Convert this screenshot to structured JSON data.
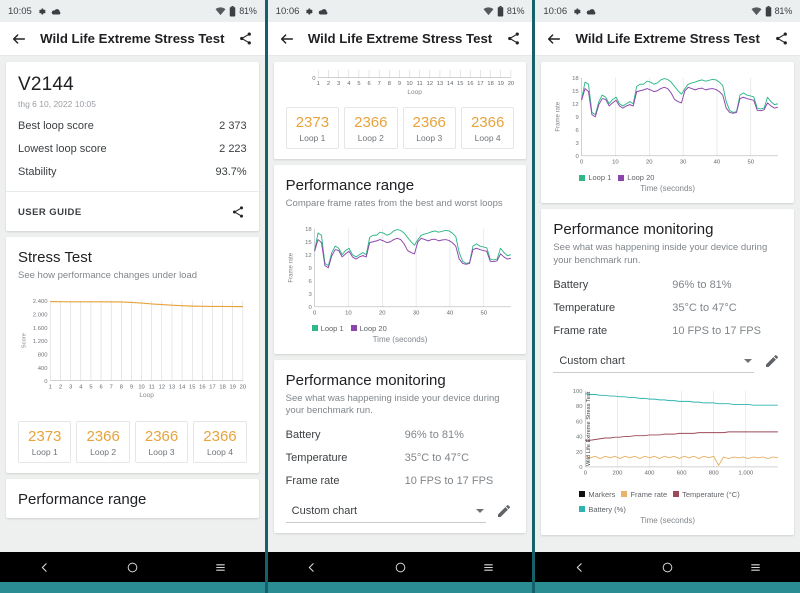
{
  "device": {
    "status_bar": {
      "time_left": "10:05",
      "time_mid": "10:06",
      "time_right": "10:06",
      "battery": "81%",
      "icons": [
        "gear-icon",
        "cloud-icon",
        "wifi-icon",
        "battery-icon"
      ]
    },
    "nav_bar": {
      "back": "back-icon",
      "home": "home-icon",
      "recents": "recents-icon"
    }
  },
  "appbar": {
    "title": "Wild Life Extreme Stress Test",
    "back_icon": "arrow-left-icon",
    "share_icon": "share-icon"
  },
  "summary": {
    "title": "V2144",
    "date": "thg 6 10, 2022 10:05",
    "rows": [
      {
        "label": "Best loop score",
        "value": "2 373"
      },
      {
        "label": "Lowest loop score",
        "value": "2 223"
      },
      {
        "label": "Stability",
        "value": "93.7%"
      }
    ],
    "user_guide": "USER GUIDE"
  },
  "stress_test": {
    "title": "Stress Test",
    "subtitle": "See how performance changes under load"
  },
  "performance_range": {
    "title": "Performance range",
    "subtitle": "Compare frame rates from the best and worst loops"
  },
  "performance_monitoring": {
    "title": "Performance monitoring",
    "subtitle": "See what was happening inside your device during your benchmark run.",
    "rows": [
      {
        "label": "Battery",
        "value": "96% to 81%"
      },
      {
        "label": "Temperature",
        "value": "35°C to 47°C"
      },
      {
        "label": "Frame rate",
        "value": "10 FPS to 17 FPS"
      }
    ],
    "chart_select": {
      "value": "Custom chart",
      "caret": "chevron-down-icon",
      "edit_icon": "pencil-icon"
    }
  },
  "loop_cards": [
    {
      "value": "2373",
      "label": "Loop 1"
    },
    {
      "value": "2366",
      "label": "Loop 2"
    },
    {
      "value": "2366",
      "label": "Loop 3"
    },
    {
      "value": "2366",
      "label": "Loop 4"
    }
  ],
  "colors": {
    "score_line": "#e8a33d",
    "loop1": "#2eb886",
    "loop20": "#8e44ad",
    "markers": "#111111",
    "frame_rate": "#e8b36a",
    "temperature": "#9c4a5a",
    "battery": "#2fb3b0",
    "accent_teal": "#2a8d94"
  },
  "chart_data": [
    {
      "id": "stress-test-chart",
      "type": "line",
      "title": "Stress Test",
      "xlabel": "Loop",
      "ylabel": "Score",
      "xlim": [
        1,
        20
      ],
      "ylim": [
        0,
        2400
      ],
      "yticks": [
        0,
        400,
        800,
        1200,
        1600,
        2000,
        2400
      ],
      "ytick_labels": [
        "0",
        "400",
        "800",
        "1.200",
        "1.600",
        "2.000",
        "2.400"
      ],
      "xticks": [
        1,
        2,
        3,
        4,
        5,
        6,
        7,
        8,
        9,
        10,
        11,
        12,
        13,
        14,
        15,
        16,
        17,
        18,
        19,
        20
      ],
      "grid": "vertical",
      "series": [
        {
          "name": "Score",
          "color": "#e8a33d",
          "values": [
            2373,
            2370,
            2368,
            2368,
            2366,
            2366,
            2365,
            2362,
            2350,
            2330,
            2305,
            2285,
            2265,
            2250,
            2238,
            2232,
            2229,
            2227,
            2225,
            2223
          ]
        }
      ]
    },
    {
      "id": "performance-range-chart",
      "type": "line",
      "title": "Performance range",
      "xlabel": "Time (seconds)",
      "ylabel": "Frame rate",
      "xlim": [
        0,
        58
      ],
      "ylim": [
        0,
        18
      ],
      "yticks": [
        0,
        3,
        6,
        9,
        12,
        15,
        18
      ],
      "xticks": [
        0,
        10,
        20,
        30,
        40,
        50
      ],
      "grid": "vertical",
      "legend": [
        "Loop 1",
        "Loop 20"
      ],
      "series": [
        {
          "name": "Loop 1",
          "color": "#2eb886",
          "values": [
            13,
            17,
            16.5,
            10,
            9.5,
            12.5,
            14,
            13.5,
            12,
            13,
            13.5,
            12,
            11.5,
            12,
            12.5,
            12,
            16,
            16.5,
            16.5,
            17.2,
            17,
            16.5,
            16.8,
            17.5,
            17.8,
            17.6,
            17,
            16,
            15,
            14.2,
            15.5,
            16.5,
            16.8,
            17,
            17.3,
            17.5,
            17.2,
            17.4,
            17.6,
            17.5,
            17,
            16.2,
            12.5,
            10.5,
            10,
            10.2,
            14,
            14.5,
            14,
            13.8,
            13.6,
            11,
            10.8,
            11,
            13.5,
            12.5,
            11.8,
            12
          ]
        },
        {
          "name": "Loop 20",
          "color": "#8e44ad",
          "values": [
            12.8,
            15.5,
            14.8,
            9.5,
            9,
            11.8,
            13.2,
            13,
            11.5,
            12.2,
            12.8,
            11.5,
            11,
            11.5,
            11.8,
            11.5,
            14.8,
            15,
            15.2,
            15.5,
            15.2,
            14.8,
            15,
            15.5,
            15.8,
            15.5,
            14.5,
            13,
            12.5,
            12.2,
            15,
            15.8,
            15.5,
            15.2,
            15.5,
            15.6,
            15.2,
            15.4,
            15.5,
            15.3,
            14.8,
            14,
            11,
            10,
            9.8,
            10,
            13.2,
            13.5,
            13.2,
            13,
            12.8,
            10.5,
            10.4,
            10.6,
            12.2,
            11.5,
            11,
            11.2
          ]
        }
      ]
    },
    {
      "id": "custom-chart",
      "type": "line",
      "title": "Custom chart",
      "xlabel": "Time (seconds)",
      "ylabel": "Wild Life Extreme Stress Test",
      "xlim": [
        0,
        1200
      ],
      "ylim": [
        0,
        100
      ],
      "yticks": [
        0,
        20,
        40,
        60,
        80,
        100
      ],
      "xticks": [
        0,
        200,
        400,
        600,
        800,
        1000
      ],
      "xtick_labels": [
        "0",
        "200",
        "400",
        "600",
        "800",
        "1.000"
      ],
      "grid": "vertical",
      "legend": [
        "Markers",
        "Frame rate",
        "Temperature (°C)",
        "Battery (%)"
      ],
      "series": [
        {
          "name": "Markers",
          "color": "#111111",
          "values": []
        },
        {
          "name": "Frame rate",
          "color": "#e8b36a",
          "values": [
            14,
            12,
            14,
            11,
            14,
            12,
            14,
            11,
            14,
            12,
            14,
            11,
            14,
            12,
            14,
            11,
            14,
            12,
            14,
            11,
            14,
            12,
            14,
            11,
            14,
            12,
            14,
            2,
            13,
            11,
            13,
            12,
            13,
            11,
            13,
            12,
            13,
            11,
            13,
            12
          ]
        },
        {
          "name": "Temperature (°C)",
          "color": "#9c4a5a",
          "values": [
            35,
            35,
            36,
            37,
            38,
            38,
            39,
            39,
            40,
            40,
            41,
            41,
            41,
            42,
            42,
            42,
            43,
            43,
            43,
            44,
            44,
            44,
            44,
            45,
            45,
            45,
            45,
            45,
            45,
            46,
            46,
            46,
            46,
            46,
            46,
            46,
            46,
            46,
            46,
            46
          ]
        },
        {
          "name": "Battery (%)",
          "color": "#2fb3b0",
          "values": [
            96,
            95,
            95,
            94,
            94,
            93,
            93,
            92,
            92,
            91,
            91,
            90,
            90,
            89,
            89,
            88,
            88,
            87,
            87,
            86,
            86,
            86,
            85,
            85,
            84,
            84,
            84,
            83,
            83,
            83,
            82,
            82,
            82,
            82,
            81,
            81,
            81,
            81,
            81,
            81
          ]
        }
      ]
    }
  ]
}
